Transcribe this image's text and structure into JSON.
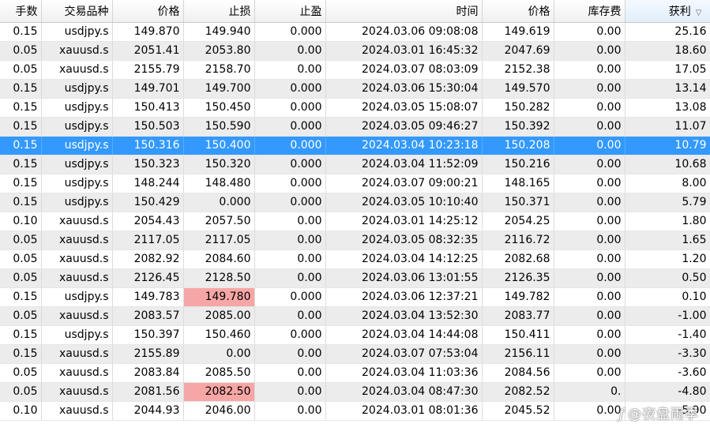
{
  "headers": [
    "手数",
    "交易品种",
    "价格",
    "止损",
    "止盈",
    "时间",
    "价格",
    "库存费",
    "获利"
  ],
  "sort_indicator": "▽",
  "rows": [
    {
      "lots": "0.15",
      "symbol": "usdjpy.s",
      "price_open": "149.870",
      "sl": "149.940",
      "tp": "0.000",
      "time": "2024.03.06 09:08:08",
      "price_cur": "149.619",
      "swap": "0.00",
      "profit": "25.16"
    },
    {
      "lots": "0.05",
      "symbol": "xauusd.s",
      "price_open": "2051.41",
      "sl": "2053.80",
      "tp": "0.00",
      "time": "2024.03.01 16:45:32",
      "price_cur": "2047.69",
      "swap": "0.00",
      "profit": "18.60"
    },
    {
      "lots": "0.05",
      "symbol": "xauusd.s",
      "price_open": "2155.79",
      "sl": "2158.70",
      "tp": "0.00",
      "time": "2024.03.07 08:03:09",
      "price_cur": "2152.38",
      "swap": "0.00",
      "profit": "17.05"
    },
    {
      "lots": "0.15",
      "symbol": "usdjpy.s",
      "price_open": "149.701",
      "sl": "149.700",
      "tp": "0.000",
      "time": "2024.03.06 15:30:04",
      "price_cur": "149.570",
      "swap": "0.00",
      "profit": "13.14"
    },
    {
      "lots": "0.15",
      "symbol": "usdjpy.s",
      "price_open": "150.413",
      "sl": "150.450",
      "tp": "0.000",
      "time": "2024.03.05 15:08:07",
      "price_cur": "150.282",
      "swap": "0.00",
      "profit": "13.08"
    },
    {
      "lots": "0.15",
      "symbol": "usdjpy.s",
      "price_open": "150.503",
      "sl": "150.590",
      "tp": "0.000",
      "time": "2024.03.05 09:46:27",
      "price_cur": "150.392",
      "swap": "0.00",
      "profit": "11.07"
    },
    {
      "lots": "0.15",
      "symbol": "usdjpy.s",
      "price_open": "150.316",
      "sl": "150.400",
      "tp": "0.000",
      "time": "2024.03.04 10:23:18",
      "price_cur": "150.208",
      "swap": "0.00",
      "profit": "10.79",
      "selected": true
    },
    {
      "lots": "0.15",
      "symbol": "usdjpy.s",
      "price_open": "150.323",
      "sl": "150.320",
      "tp": "0.000",
      "time": "2024.03.04 11:52:09",
      "price_cur": "150.216",
      "swap": "0.00",
      "profit": "10.68"
    },
    {
      "lots": "0.15",
      "symbol": "usdjpy.s",
      "price_open": "148.244",
      "sl": "148.480",
      "tp": "0.000",
      "time": "2024.03.07 09:00:21",
      "price_cur": "148.165",
      "swap": "0.00",
      "profit": "8.00"
    },
    {
      "lots": "0.15",
      "symbol": "usdjpy.s",
      "price_open": "150.429",
      "sl": "0.000",
      "tp": "0.000",
      "time": "2024.03.05 10:10:40",
      "price_cur": "150.371",
      "swap": "0.00",
      "profit": "5.79"
    },
    {
      "lots": "0.10",
      "symbol": "xauusd.s",
      "price_open": "2054.43",
      "sl": "2057.50",
      "tp": "0.00",
      "time": "2024.03.01 14:25:12",
      "price_cur": "2054.25",
      "swap": "0.00",
      "profit": "1.80"
    },
    {
      "lots": "0.05",
      "symbol": "xauusd.s",
      "price_open": "2117.05",
      "sl": "2117.05",
      "tp": "0.00",
      "time": "2024.03.05 08:32:35",
      "price_cur": "2116.72",
      "swap": "0.00",
      "profit": "1.65"
    },
    {
      "lots": "0.05",
      "symbol": "xauusd.s",
      "price_open": "2082.92",
      "sl": "2084.60",
      "tp": "0.00",
      "time": "2024.03.04 14:12:25",
      "price_cur": "2082.68",
      "swap": "0.00",
      "profit": "1.20"
    },
    {
      "lots": "0.05",
      "symbol": "xauusd.s",
      "price_open": "2126.45",
      "sl": "2128.50",
      "tp": "0.00",
      "time": "2024.03.06 13:01:55",
      "price_cur": "2126.35",
      "swap": "0.00",
      "profit": "0.50"
    },
    {
      "lots": "0.15",
      "symbol": "usdjpy.s",
      "price_open": "149.783",
      "sl": "149.780",
      "tp": "0.000",
      "time": "2024.03.06 12:37:21",
      "price_cur": "149.782",
      "swap": "0.00",
      "profit": "0.10",
      "sl_highlight": true
    },
    {
      "lots": "0.05",
      "symbol": "xauusd.s",
      "price_open": "2083.57",
      "sl": "2085.00",
      "tp": "0.00",
      "time": "2024.03.04 13:52:30",
      "price_cur": "2083.77",
      "swap": "0.00",
      "profit": "-1.00"
    },
    {
      "lots": "0.15",
      "symbol": "usdjpy.s",
      "price_open": "150.397",
      "sl": "150.460",
      "tp": "0.000",
      "time": "2024.03.04 14:44:08",
      "price_cur": "150.411",
      "swap": "0.00",
      "profit": "-1.40"
    },
    {
      "lots": "0.15",
      "symbol": "xauusd.s",
      "price_open": "2155.89",
      "sl": "0.00",
      "tp": "0.00",
      "time": "2024.03.07 07:53:04",
      "price_cur": "2156.11",
      "swap": "0.00",
      "profit": "-3.30"
    },
    {
      "lots": "0.05",
      "symbol": "xauusd.s",
      "price_open": "2083.84",
      "sl": "2085.50",
      "tp": "0.00",
      "time": "2024.03.04 11:03:36",
      "price_cur": "2084.56",
      "swap": "0.00",
      "profit": "-3.60"
    },
    {
      "lots": "0.05",
      "symbol": "xauusd.s",
      "price_open": "2081.56",
      "sl": "2082.50",
      "tp": "0.00",
      "time": "2024.03.04 08:47:30",
      "price_cur": "2082.52",
      "swap": "0.",
      "profit": "-4.80",
      "sl_highlight": true
    },
    {
      "lots": "0.10",
      "symbol": "xauusd.s",
      "price_open": "2044.93",
      "sl": "2046.00",
      "tp": "0.00",
      "time": "2024.03.01 08:01:36",
      "price_cur": "2045.52",
      "swap": "0.00",
      "profit": "-5.90"
    }
  ],
  "colors": {
    "selected_row": "#3399ff",
    "alt_row": "#ececec",
    "sl_highlight": "#f7a6a6"
  },
  "watermark": {
    "icon": "ƒ",
    "text": "@夜盘雨季"
  }
}
